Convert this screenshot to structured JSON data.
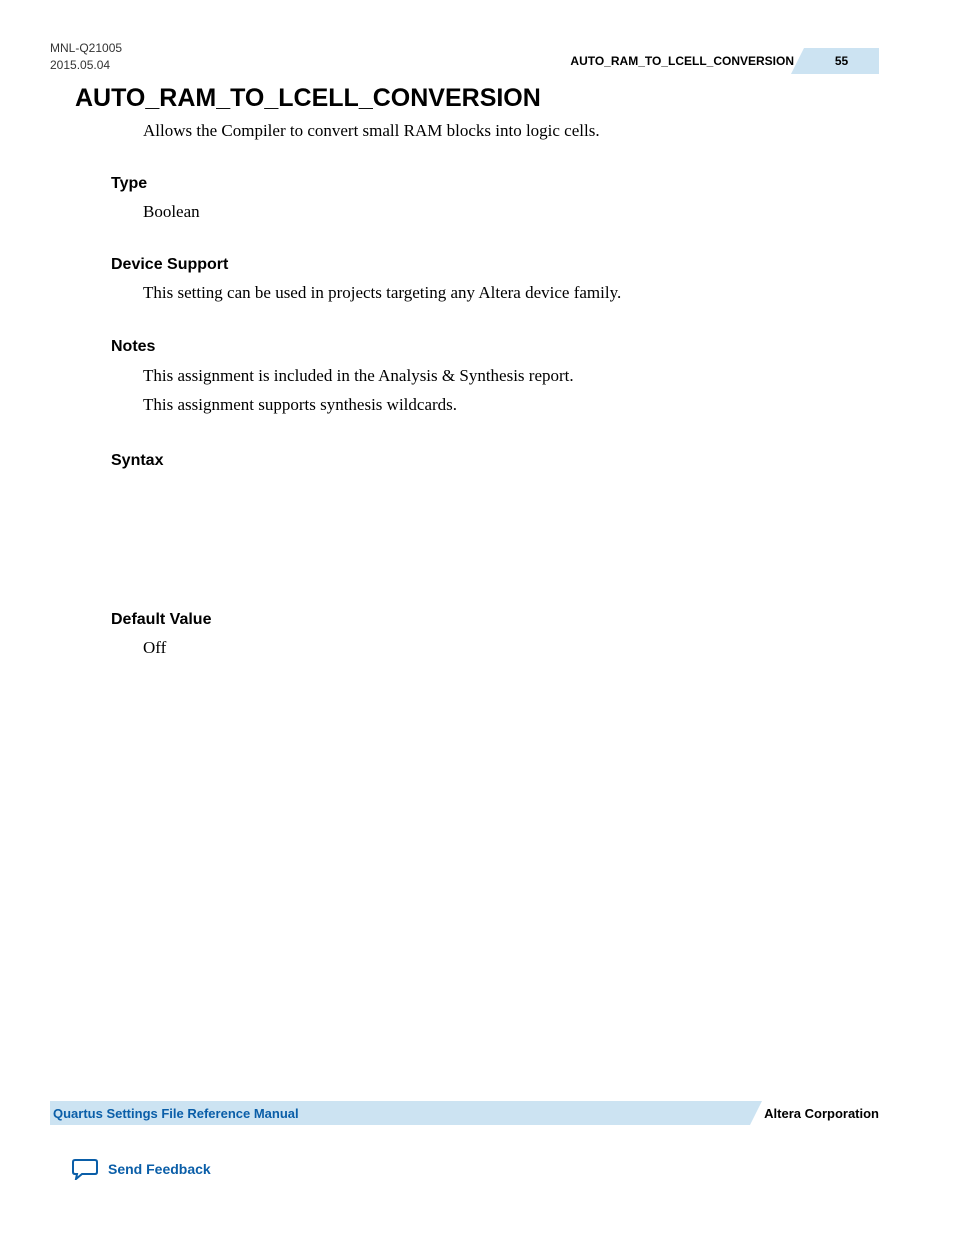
{
  "header": {
    "doc_id": "MNL-Q21005",
    "date": "2015.05.04",
    "title_right": "AUTO_RAM_TO_LCELL_CONVERSION",
    "page_number": "55"
  },
  "main": {
    "heading": "AUTO_RAM_TO_LCELL_CONVERSION",
    "intro": "Allows the Compiler to convert small RAM blocks into logic cells.",
    "sections": {
      "type": {
        "label": "Type",
        "value": "Boolean"
      },
      "device_support": {
        "label": "Device Support",
        "value": "This setting can be used in projects targeting any Altera device family."
      },
      "notes": {
        "label": "Notes",
        "line1": "This assignment is included in the Analysis & Synthesis report.",
        "line2": "This assignment supports synthesis wildcards."
      },
      "syntax": {
        "label": "Syntax"
      },
      "default_value": {
        "label": "Default Value",
        "value": "Off"
      }
    }
  },
  "footer": {
    "manual_title": "Quartus Settings File Reference Manual",
    "company": "Altera Corporation",
    "feedback_label": "Send Feedback"
  }
}
